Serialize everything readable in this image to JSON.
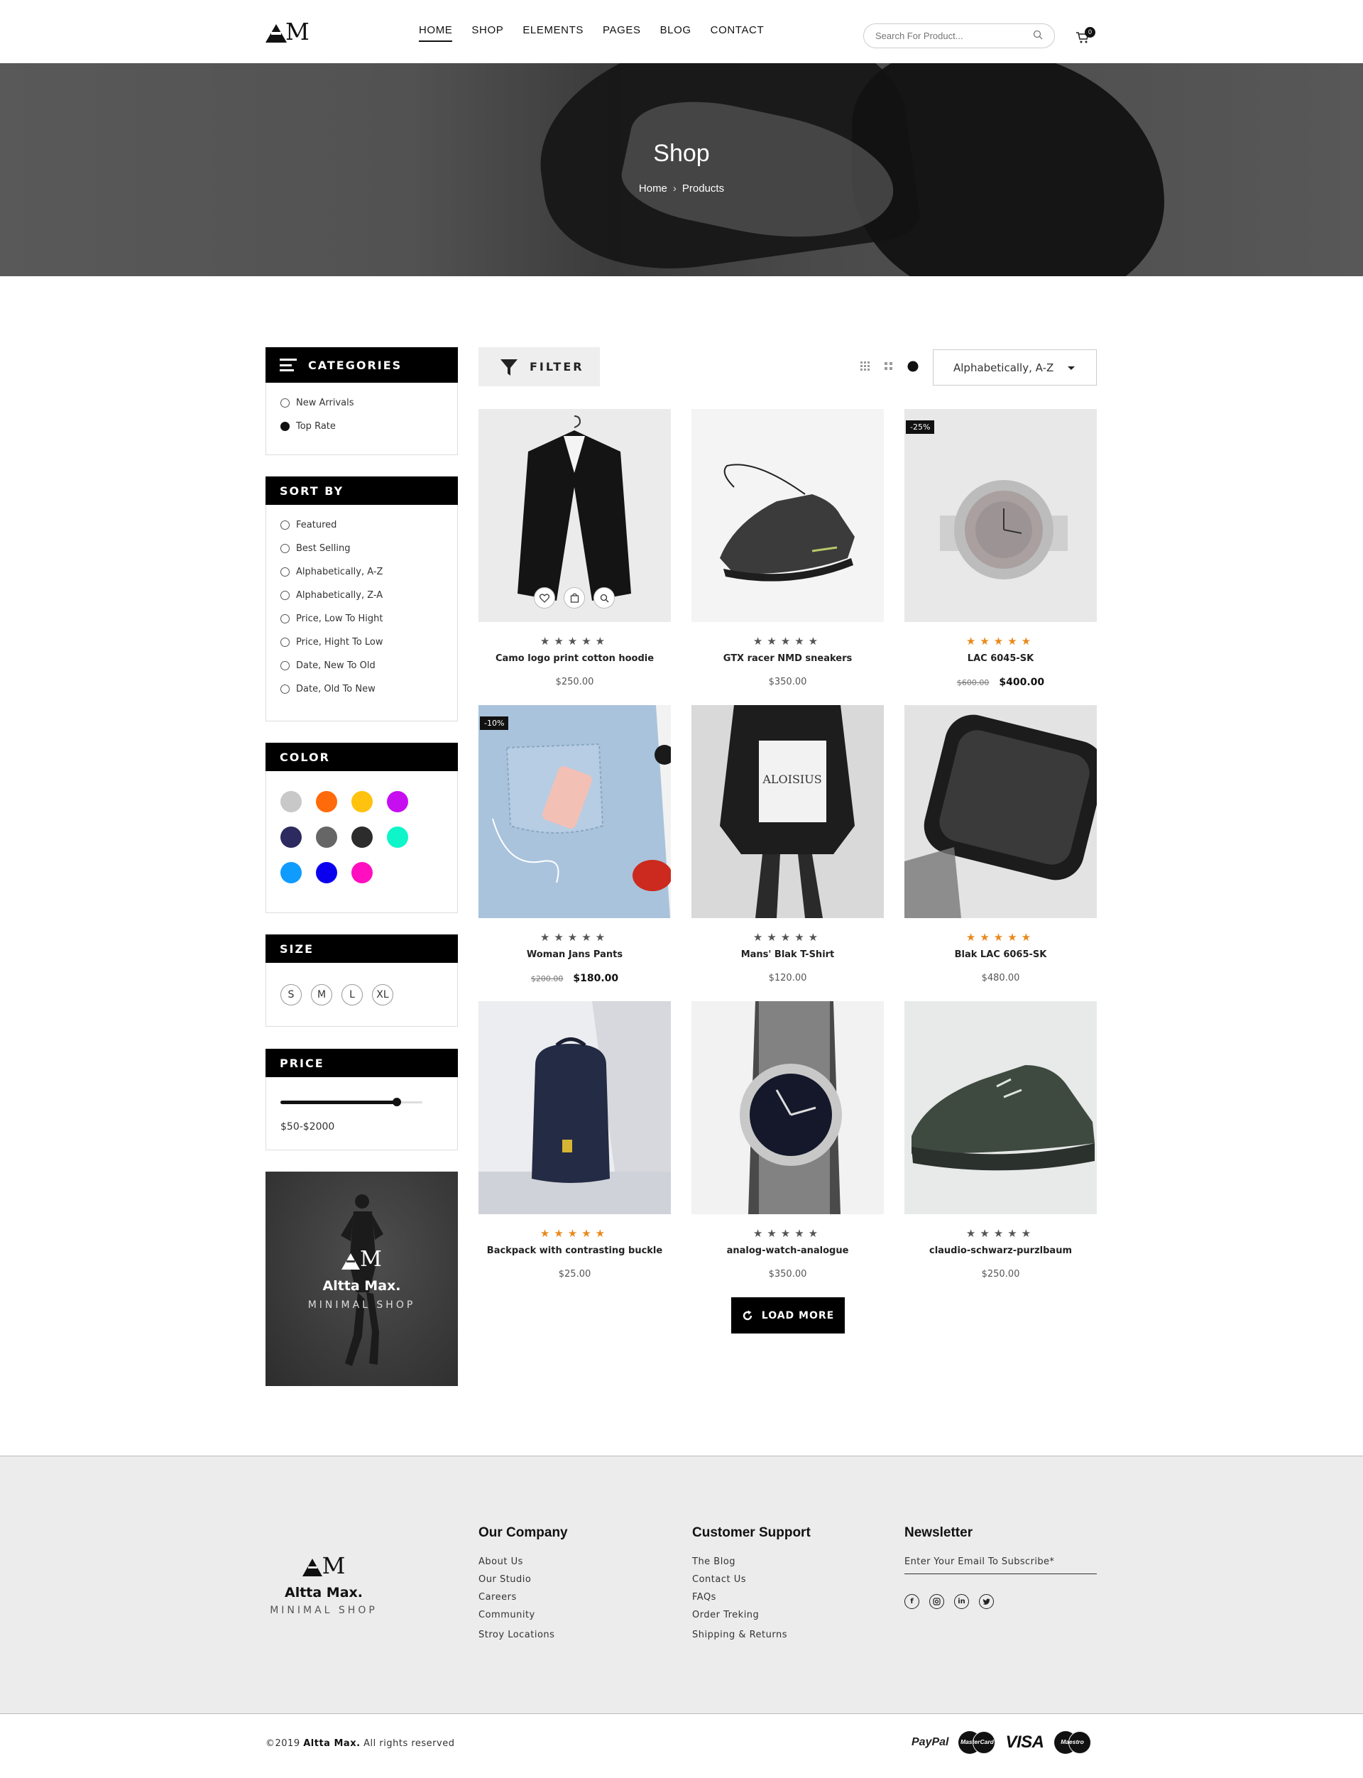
{
  "header": {
    "logo_text": "AM",
    "nav": [
      "HOME",
      "SHOP",
      "ELEMENTS",
      "PAGES",
      "BLOG",
      "CONTACT"
    ],
    "active_nav": "HOME",
    "search_placeholder": "Search For Product...",
    "cart_count": "0"
  },
  "hero": {
    "title": "Shop",
    "breadcrumb": [
      "Home",
      "Products"
    ]
  },
  "sidebar": {
    "categories": {
      "title": "CATEGORIES",
      "items": [
        {
          "label": "New Arrivals",
          "selected": false
        },
        {
          "label": "Top Rate",
          "selected": true
        }
      ]
    },
    "sort_by": {
      "title": "SORT BY",
      "items": [
        "Featured",
        "Best Selling",
        "Alphabetically, A-Z",
        "Alphabetically, Z-A",
        "Price, Low To Hight",
        "Price, Hight To Low",
        "Date, New To Old",
        "Date, Old To New"
      ]
    },
    "color": {
      "title": "COLOR",
      "swatches": [
        "#c8c8c8",
        "#ff6a0b",
        "#ffc20e",
        "#c60ef1",
        "#2c2a5e",
        "#666666",
        "#2c2c2c",
        "#0ef5c9",
        "#109bff",
        "#0a00ee",
        "#ff0fbf"
      ]
    },
    "size": {
      "title": "SIZE",
      "options": [
        "S",
        "M",
        "L",
        "XL"
      ]
    },
    "price": {
      "title": "PRICE",
      "range_label": "$50-$2000",
      "min_fraction": 0.0,
      "max_fraction": 0.82
    },
    "promo": {
      "logo_text": "AM",
      "name": "Altta Max.",
      "tagline": "MINIMAL SHOP"
    }
  },
  "toolbar": {
    "filter_label": "FILTER",
    "sort_value": "Alphabetically, A-Z"
  },
  "products": [
    {
      "name": "Camo logo print cotton hoodie",
      "price": "$250.00",
      "old_price": "",
      "badge": "",
      "rating_gold": false,
      "image": "black-suit-jacket"
    },
    {
      "name": "GTX racer NMD sneakers",
      "price": "$350.00",
      "old_price": "",
      "badge": "",
      "rating_gold": false,
      "image": "black-sneaker"
    },
    {
      "name": "LAC 6045-SK",
      "price": "$400.00",
      "old_price": "$600.00",
      "badge": "-25%",
      "rating_gold": true,
      "image": "silver-watch"
    },
    {
      "name": "Woman Jans Pants",
      "price": "$180.00",
      "old_price": "$200.00",
      "badge": "-10%",
      "rating_gold": false,
      "image": "jeans-pocket"
    },
    {
      "name": "Mans' Blak T-Shirt",
      "price": "$120.00",
      "old_price": "",
      "badge": "",
      "rating_gold": false,
      "image": "black-sweatshirt"
    },
    {
      "name": "Blak LAC 6065-SK",
      "price": "$480.00",
      "old_price": "",
      "badge": "",
      "rating_gold": true,
      "image": "smart-watch"
    },
    {
      "name": "Backpack with contrasting buckle",
      "price": "$25.00",
      "old_price": "",
      "badge": "",
      "rating_gold": true,
      "image": "navy-backpack"
    },
    {
      "name": "analog-watch-analogue",
      "price": "$350.00",
      "old_price": "",
      "badge": "",
      "rating_gold": false,
      "image": "steel-watch"
    },
    {
      "name": "claudio-schwarz-purzlbaum",
      "price": "$250.00",
      "old_price": "",
      "badge": "",
      "rating_gold": false,
      "image": "green-sneaker"
    }
  ],
  "stars": "★★★★★",
  "load_more_label": "LOAD MORE",
  "footer": {
    "logo_text": "AM",
    "brand_name": "Altta Max.",
    "brand_tagline": "MINIMAL SHOP",
    "company": {
      "title": "Our Company",
      "links": [
        "About Us",
        "Our Studio",
        "Careers",
        "Community",
        "Stroy Locations"
      ]
    },
    "support": {
      "title": "Customer Support",
      "links": [
        "The Blog",
        "Contact Us",
        "FAQs",
        "Order Treking",
        "Shipping & Returns"
      ]
    },
    "newsletter": {
      "title": "Newsletter",
      "placeholder": "Enter Your Email To Subscribe*",
      "socials": [
        "facebook-icon",
        "instagram-icon",
        "linkedin-icon",
        "twitter-icon"
      ]
    },
    "copyright_prefix": "©2019",
    "copyright_brand": "Altta Max.",
    "copyright_suffix": "All rights reserved",
    "payments": {
      "paypal": "PayPal",
      "mastercard": "MasterCard",
      "visa": "VISA",
      "maestro": "Maestro"
    }
  }
}
